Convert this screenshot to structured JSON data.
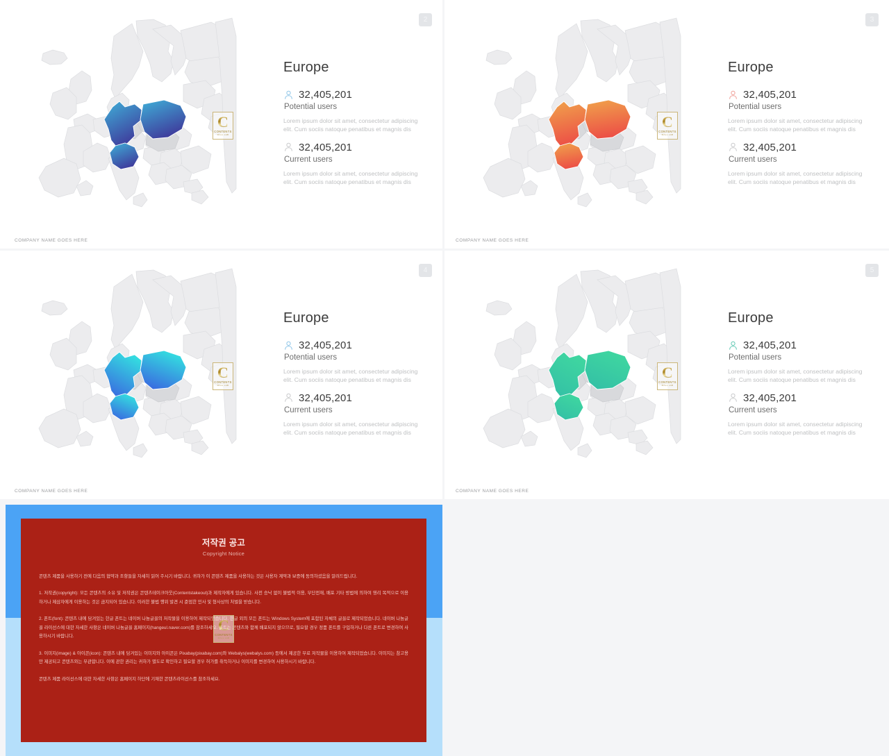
{
  "slides": [
    {
      "id": "slide-2",
      "page_number": "2",
      "title": "Europe",
      "footer": "COMPANY NAME GOES HERE",
      "stats": [
        {
          "icon": "user-icon",
          "icon_color": "#8fc6e8",
          "number": "32,405,201",
          "label": "Potential users",
          "description": "Lorem ipsum dolor sit amet, consectetur adipiscing elit. Cum sociis natoque penatibus et magnis dis"
        },
        {
          "icon": "user-icon",
          "icon_color": "#c9cacc",
          "number": "32,405,201",
          "label": "Current users",
          "description": "Lorem ipsum dolor sit amet, consectetur adipiscing elit. Cum sociis natoque penatibus et magnis dis"
        }
      ],
      "map": {
        "highlight_gradient": [
          "#3fb0d8",
          "#3f3f9e"
        ],
        "highlight_regions": [
          "Germany",
          "Poland",
          "Austria"
        ],
        "mid_regions": [
          "Czechia",
          "Slovakia",
          "Hungary"
        ]
      }
    },
    {
      "id": "slide-3",
      "page_number": "3",
      "title": "Europe",
      "footer": "COMPANY NAME GOES HERE",
      "stats": [
        {
          "icon": "user-icon",
          "icon_color": "#f0a199",
          "number": "32,405,201",
          "label": "Potential users",
          "description": "Lorem ipsum dolor sit amet, consectetur adipiscing elit. Cum sociis natoque penatibus et magnis dis"
        },
        {
          "icon": "user-icon",
          "icon_color": "#c9cacc",
          "number": "32,405,201",
          "label": "Current users",
          "description": "Lorem ipsum dolor sit amet, consectetur adipiscing elit. Cum sociis natoque penatibus et magnis dis"
        }
      ],
      "map": {
        "highlight_gradient": [
          "#f0a04b",
          "#ec4e46"
        ],
        "highlight_regions": [
          "Germany",
          "Poland",
          "Austria"
        ],
        "mid_regions": [
          "Czechia",
          "Slovakia",
          "Hungary"
        ]
      }
    },
    {
      "id": "slide-4",
      "page_number": "4",
      "title": "Europe",
      "footer": "COMPANY NAME GOES HERE",
      "stats": [
        {
          "icon": "user-icon",
          "icon_color": "#8fc6e8",
          "number": "32,405,201",
          "label": "Potential users",
          "description": "Lorem ipsum dolor sit amet, consectetur adipiscing elit. Cum sociis natoque penatibus et magnis dis"
        },
        {
          "icon": "user-icon",
          "icon_color": "#c9cacc",
          "number": "32,405,201",
          "label": "Current users",
          "description": "Lorem ipsum dolor sit amet, consectetur adipiscing elit. Cum sociis natoque penatibus et magnis dis"
        }
      ],
      "map": {
        "highlight_gradient": [
          "#34dbe0",
          "#3a63e0"
        ],
        "highlight_regions": [
          "Germany",
          "Poland",
          "Austria"
        ],
        "mid_regions": [
          "Czechia",
          "Slovakia",
          "Hungary"
        ]
      }
    },
    {
      "id": "slide-5",
      "page_number": "5",
      "title": "Europe",
      "footer": "COMPANY NAME GOES HERE",
      "stats": [
        {
          "icon": "user-icon",
          "icon_color": "#63c9b4",
          "number": "32,405,201",
          "label": "Potential users",
          "description": "Lorem ipsum dolor sit amet, consectetur adipiscing elit. Cum sociis natoque penatibus et magnis dis"
        },
        {
          "icon": "user-icon",
          "icon_color": "#c9cacc",
          "number": "32,405,201",
          "label": "Current users",
          "description": "Lorem ipsum dolor sit amet, consectetur adipiscing elit. Cum sociis natoque penatibus et magnis dis"
        }
      ],
      "map": {
        "highlight_gradient": [
          "#3fd6a0",
          "#33bfa6"
        ],
        "highlight_regions": [
          "Germany",
          "Poland",
          "Austria"
        ],
        "mid_regions": [
          "Czechia",
          "Slovakia",
          "Hungary"
        ]
      }
    }
  ],
  "watermark": {
    "letter": "C",
    "line1": "CONTENTS",
    "line2": "MALL LAB"
  },
  "copyright_slide": {
    "title": "저작권 공고",
    "subtitle": "Copyright Notice",
    "frame_top_color": "#4ba3f5",
    "frame_bottom_color": "#b5dffb",
    "card_color": "#ab2116",
    "paragraphs": [
      "콘텐츠 제품을 사용하기 전에 다음의 협약과 조항들을 자세히 읽어 주시기 바랍니다. 귀하가 이 콘텐츠 제품을 사용하는 것은 사용자 계약과 보증에 동의하셨음을 알려드립니다.",
      "1. 저작권(copyright): 모든 콘텐츠의 소유 및 저작권은 콘텐츠테이크아웃(Contentstakeout)과 제작자에게 있습니다. 사전 승낙 없이 불법적 이용, 무단전재, 배포 기타 방법에 의하여 영리 목적으로 이용하거나 제삼자에게 이용하는 것은 금지되어 있습니다. 이러한 불법 행위 발견 시 준엄한 민사 및 형사상의 처벌을 받습니다.",
      "2. 폰트(font): 콘텐츠 내에 담겨있는 한글 폰트는 네이버 나눔글꼴의 저작물을 이용하여 제작되었습니다. 한글 외의 모든 폰트는 Windows System에 포함된 자체의 글꼴로 제작되었습니다. 네이버 나눔글꼴 라이선스에 대한 자세한 사항은 네이버 나눔글꼴 홈페이지(hangeul.naver.com)를 참조하세요. 폰트는 콘텐츠와 함께 배포되지 않으므로, 필요할 경우 정품 폰트를 구입하거나 다른 폰트로 변경하여 사용하시기 바랍니다.",
      "3. 이미지(image) & 아이콘(icon): 콘텐츠 내에 담겨있는 이미지와 아이콘은 Pixabay(pixabay.com)와 Webalys(webalys.com) 등에서 제공한 무료 저작물을 이용하여 제작되었습니다. 이미지는 참고용만 제공되고 콘텐츠와는 무관합니다. 이에 관한 권리는 귀하가 별도로 확인하고 필요할 경우 허가를 취득하거나 이미지를 변경하여 사용하시기 바랍니다.",
      "콘텐츠 제품 라이선스에 대한 자세한 사항은 홈페이지 하단에 기재한 콘텐츠라이선스를 참조하세요."
    ]
  }
}
